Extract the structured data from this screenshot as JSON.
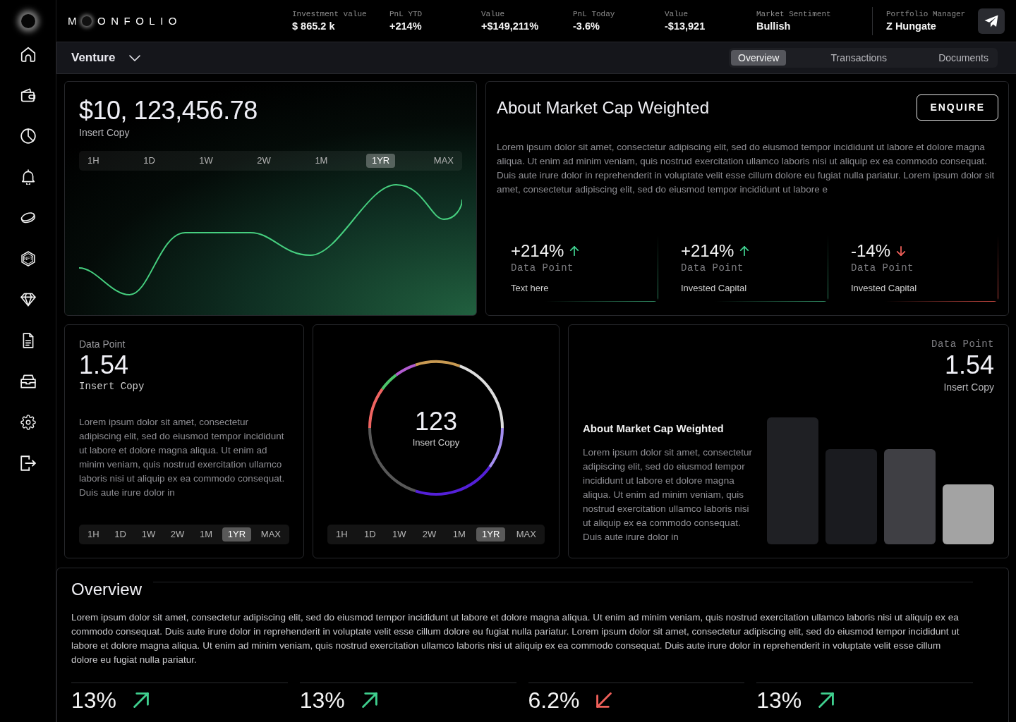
{
  "sidebar": {
    "nft_label": "NFT"
  },
  "brand": {
    "first": "M",
    "rest": "ONFOLIO"
  },
  "header_stats": [
    {
      "label": "Investment value",
      "value": "$ 865.2 k"
    },
    {
      "label": "PnL YTD",
      "value": "+214%"
    },
    {
      "label": "Value",
      "value": "+$149,211%"
    },
    {
      "label": "PnL Today",
      "value": "-3.6%"
    },
    {
      "label": "Value",
      "value": "-$13,921"
    },
    {
      "label": "Market Sentiment",
      "value": "Bullish"
    }
  ],
  "manager": {
    "label": "Portfolio Manager",
    "value": "Z Hungate"
  },
  "subheader": {
    "title": "Venture",
    "tabs": [
      {
        "label": "Overview",
        "selected": true
      },
      {
        "label": "Transactions",
        "selected": false
      },
      {
        "label": "Documents",
        "selected": false
      }
    ]
  },
  "balance_card": {
    "amount": "$10, 123,456.78",
    "caption": "Insert Copy",
    "ranges": [
      {
        "label": "1H",
        "selected": false
      },
      {
        "label": "1D",
        "selected": false
      },
      {
        "label": "1W",
        "selected": false
      },
      {
        "label": "2W",
        "selected": false
      },
      {
        "label": "1M",
        "selected": false
      },
      {
        "label": "1YR",
        "selected": true
      },
      {
        "label": "MAX",
        "selected": false
      }
    ]
  },
  "about_card": {
    "title": "About Market Cap Weighted",
    "button": "ENQUIRE",
    "text": "Lorem ipsum dolor sit amet, consectetur adipiscing elit, sed do eiusmod tempor incididunt ut labore et dolore magna aliqua. Ut enim ad minim veniam, quis nostrud exercitation ullamco laboris nisi ut aliquip ex ea commodo consequat. Duis aute irure dolor in reprehenderit in voluptate velit esse cillum dolore eu fugiat nulla pariatur. Lorem ipsum dolor sit amet, consectetur adipiscing elit, sed do eiusmod tempor incididunt ut labore e",
    "metrics": [
      {
        "kind": "up",
        "value": "+214%",
        "label": "Data Point",
        "caption": "Text here"
      },
      {
        "kind": "up",
        "value": "+214%",
        "label": "Data Point",
        "caption": "Invested Capital"
      },
      {
        "kind": "down",
        "value": "-14%",
        "label": "Data Point",
        "caption": "Invested Capital"
      }
    ]
  },
  "data_card": {
    "label": "Data Point",
    "value": "1.54",
    "caption": "Insert Copy",
    "text": "Lorem ipsum dolor sit amet, consectetur adipiscing elit, sed do eiusmod tempor incididunt ut labore et dolore magna aliqua. Ut enim ad minim veniam, quis nostrud exercitation ullamco laboris nisi ut aliquip ex ea commodo consequat. Duis aute irure dolor in",
    "ranges": [
      {
        "label": "1H",
        "selected": false
      },
      {
        "label": "1D",
        "selected": false
      },
      {
        "label": "1W",
        "selected": false
      },
      {
        "label": "2W",
        "selected": false
      },
      {
        "label": "1M",
        "selected": false
      },
      {
        "label": "1YR",
        "selected": true
      },
      {
        "label": "MAX",
        "selected": false
      }
    ]
  },
  "ring_card": {
    "value": "123",
    "caption": "Insert Copy",
    "ranges": [
      {
        "label": "1H",
        "selected": false
      },
      {
        "label": "1D",
        "selected": false
      },
      {
        "label": "1W",
        "selected": false
      },
      {
        "label": "2W",
        "selected": false
      },
      {
        "label": "1M",
        "selected": false
      },
      {
        "label": "1YR",
        "selected": true
      },
      {
        "label": "MAX",
        "selected": false
      }
    ]
  },
  "bars_card": {
    "label": "Data Point",
    "value": "1.54",
    "caption": "Insert Copy",
    "title": "About Market Cap Weighted",
    "text": "Lorem ipsum dolor sit amet, consectetur adipiscing elit, sed do eiusmod tempor incididunt ut labore et dolore magna aliqua. Ut enim ad minim veniam, quis nostrud exercitation ullamco laboris nisi ut aliquip ex ea commodo consequat. Duis aute irure dolor in"
  },
  "overview": {
    "title": "Overview",
    "text": "Lorem ipsum dolor sit amet, consectetur adipiscing elit, sed do eiusmod tempor incididunt ut labore et dolore magna aliqua. Ut enim ad minim veniam, quis nostrud exercitation ullamco laboris nisi ut aliquip ex ea commodo consequat. Duis aute irure dolor in reprehenderit in voluptate velit esse cillum dolore eu fugiat nulla pariatur. Lorem ipsum dolor sit amet, consectetur adipiscing elit, sed do eiusmod tempor incididunt ut labore et dolore magna aliqua. Ut enim ad minim veniam, quis nostrud exercitation ullamco laboris nisi ut aliquip ex ea commodo consequat. Duis aute irure dolor in reprehenderit in voluptate velit esse cillum dolore eu fugiat nulla pariatur.",
    "metrics": [
      {
        "kind": "up",
        "value": "13%"
      },
      {
        "kind": "up",
        "value": "13%"
      },
      {
        "kind": "down",
        "value": "6.2%"
      },
      {
        "kind": "up",
        "value": "13%"
      }
    ]
  }
}
